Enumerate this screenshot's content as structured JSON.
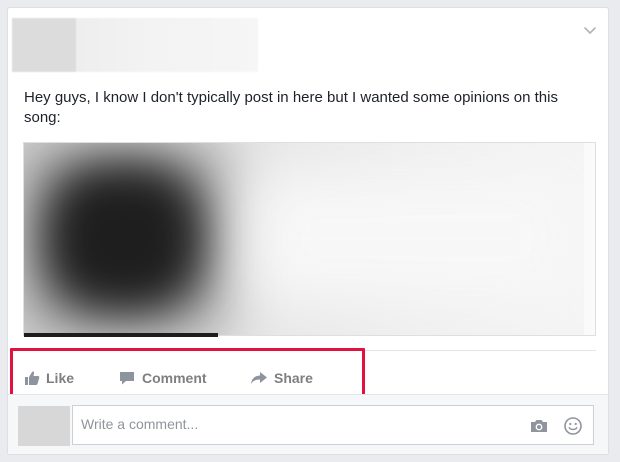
{
  "post": {
    "text": "Hey guys, I know I don't typically post in here but I wanted some opinions on this song:",
    "link_preview": {
      "progress_fraction": 0.34
    }
  },
  "actions": {
    "like_label": "Like",
    "comment_label": "Comment",
    "share_label": "Share"
  },
  "comment_box": {
    "placeholder": "Write a comment..."
  },
  "icons": {
    "options": "chevron-down-icon",
    "like": "thumbs-up-icon",
    "comment": "speech-bubble-icon",
    "share": "share-arrow-icon",
    "camera": "camera-icon",
    "emoji": "smiley-icon"
  },
  "colors": {
    "highlight": "#e0123f",
    "action_text": "#7f7f7f",
    "page_background": "#e9ebee"
  }
}
